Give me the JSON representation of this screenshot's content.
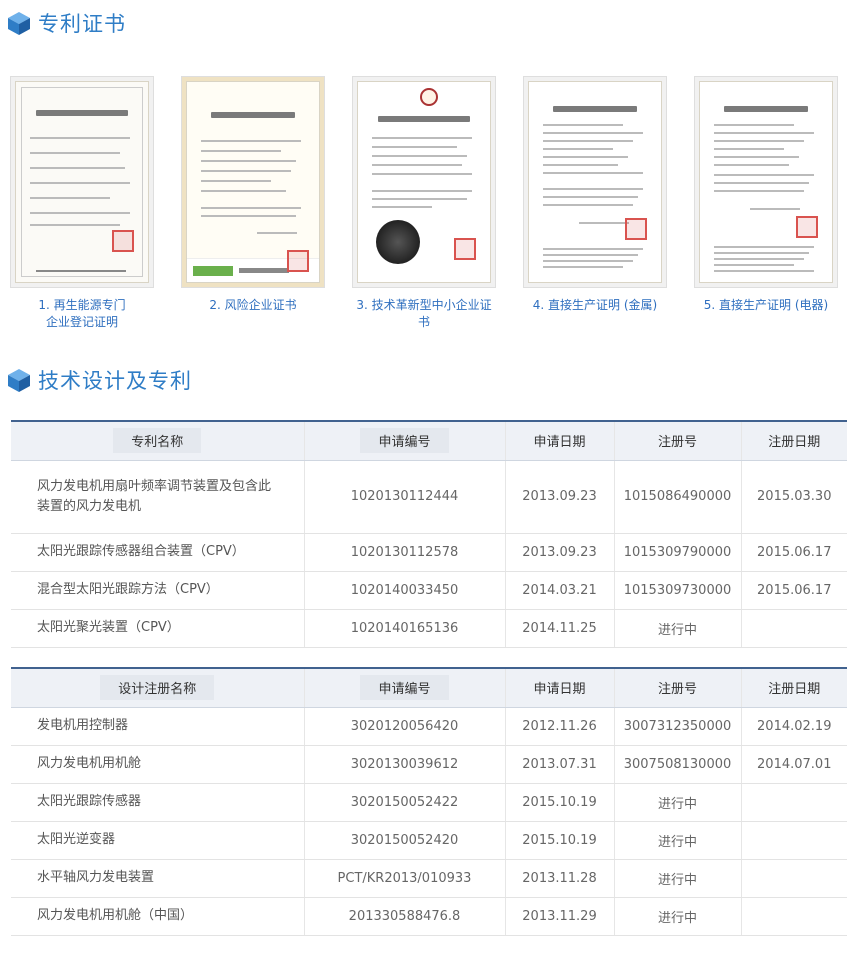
{
  "section1": {
    "title": "专利证书"
  },
  "certificates": [
    {
      "caption": "1. 再生能源专门\n企业登记证明"
    },
    {
      "caption": "2. 风险企业证书"
    },
    {
      "caption": "3. 技术革新型中小企业证书"
    },
    {
      "caption": "4. 直接生产证明 (金属)"
    },
    {
      "caption": "5. 直接生产证明 (电器)"
    }
  ],
  "section2": {
    "title": "技术设计及专利"
  },
  "patents": {
    "headers": [
      "专利名称",
      "申请编号",
      "申请日期",
      "注册号",
      "注册日期"
    ],
    "rows": [
      [
        "风力发电机用扇叶频率调节装置及包含此装置的风力发电机",
        "1020130112444",
        "2013.09.23",
        "1015086490000",
        "2015.03.30"
      ],
      [
        "太阳光跟踪传感器组合装置（CPV）",
        "1020130112578",
        "2013.09.23",
        "1015309790000",
        "2015.06.17"
      ],
      [
        "混合型太阳光跟踪方法（CPV）",
        "1020140033450",
        "2014.03.21",
        "1015309730000",
        "2015.06.17"
      ],
      [
        "太阳光聚光装置（CPV）",
        "1020140165136",
        "2014.11.25",
        "进行中",
        ""
      ]
    ]
  },
  "designs": {
    "headers": [
      "设计注册名称",
      "申请编号",
      "申请日期",
      "注册号",
      "注册日期"
    ],
    "rows": [
      [
        "发电机用控制器",
        "3020120056420",
        "2012.11.26",
        "3007312350000",
        "2014.02.19"
      ],
      [
        "风力发电机用机舱",
        "3020130039612",
        "2013.07.31",
        "3007508130000",
        "2014.07.01"
      ],
      [
        "太阳光跟踪传感器",
        "3020150052422",
        "2015.10.19",
        "进行中",
        ""
      ],
      [
        "太阳光逆变器",
        "3020150052420",
        "2015.10.19",
        "进行中",
        ""
      ],
      [
        "水平轴风力发电装置",
        "PCT/KR2013/010933",
        "2013.11.28",
        "进行中",
        ""
      ],
      [
        "风力发电机用机舱（中国）",
        "201330588476.8",
        "2013.11.29",
        "进行中",
        ""
      ]
    ]
  },
  "colors": {
    "accent": "#2f7dc6",
    "header_border": "#41628f",
    "header_bg": "#eef1f6"
  }
}
